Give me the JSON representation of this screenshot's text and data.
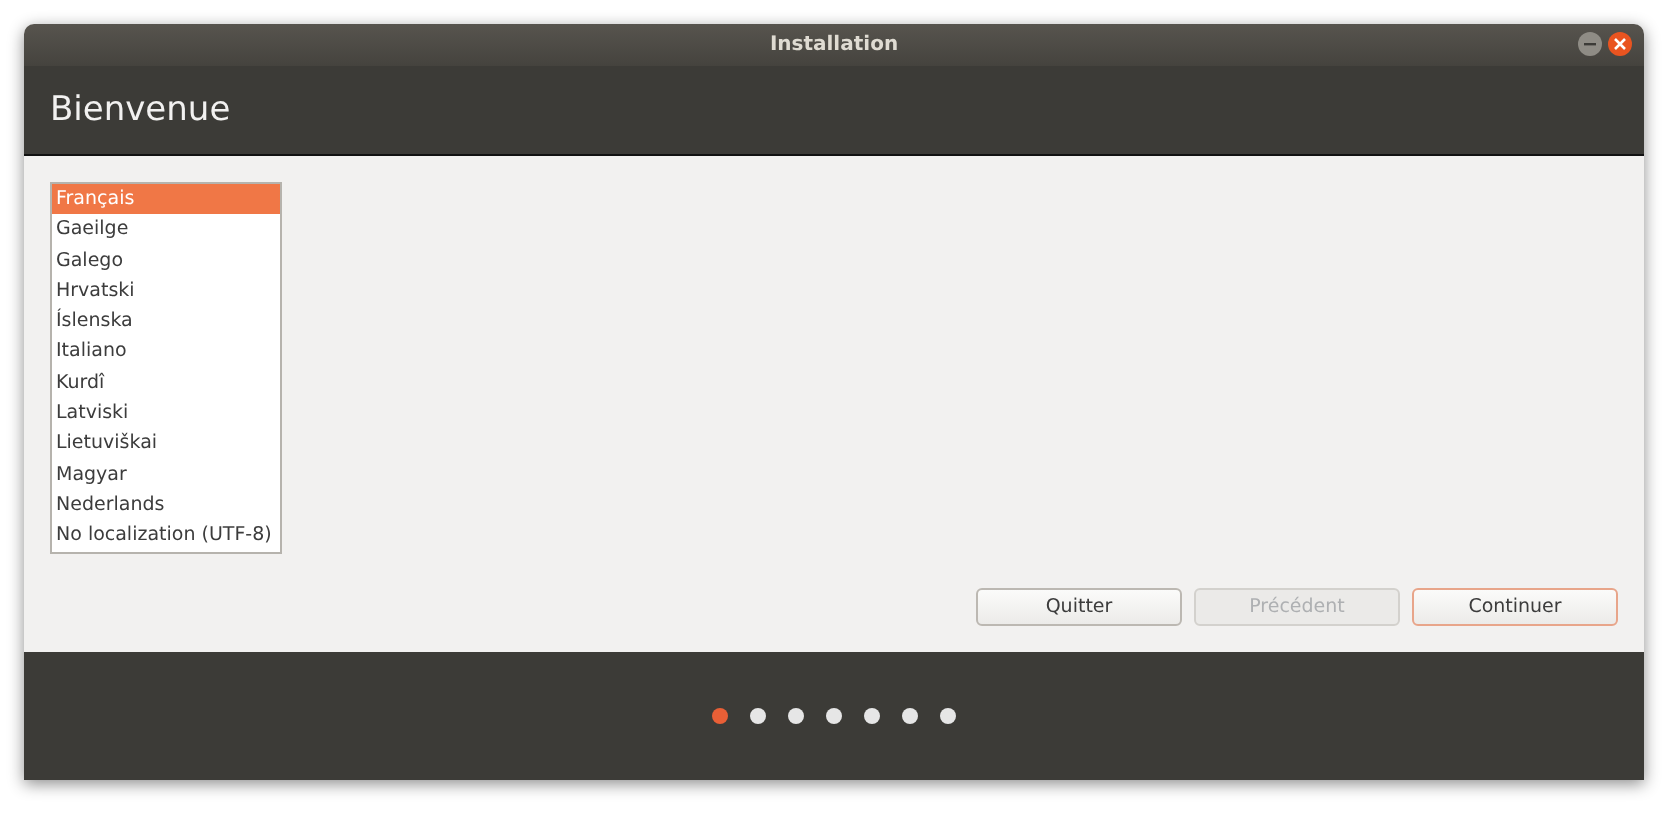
{
  "window": {
    "title": "Installation"
  },
  "header": {
    "title": "Bienvenue"
  },
  "languages": [
    {
      "label": "Français",
      "selected": true
    },
    {
      "label": "Gaeilge",
      "selected": false
    },
    {
      "label": "Galego",
      "selected": false
    },
    {
      "label": "Hrvatski",
      "selected": false
    },
    {
      "label": "Íslenska",
      "selected": false
    },
    {
      "label": "Italiano",
      "selected": false
    },
    {
      "label": "Kurdî",
      "selected": false
    },
    {
      "label": "Latviski",
      "selected": false
    },
    {
      "label": "Lietuviškai",
      "selected": false
    },
    {
      "label": "Magyar",
      "selected": false
    },
    {
      "label": "Nederlands",
      "selected": false
    },
    {
      "label": "No localization (UTF-8)",
      "selected": false
    }
  ],
  "buttons": [
    {
      "label": "Quitter",
      "kind": "normal",
      "disabled": false
    },
    {
      "label": "Précédent",
      "kind": "normal",
      "disabled": true
    },
    {
      "label": "Continuer",
      "kind": "suggested",
      "disabled": false
    }
  ],
  "progress_steps": [
    {
      "selected": true
    },
    {
      "selected": false
    },
    {
      "selected": false
    },
    {
      "selected": false
    },
    {
      "selected": false
    },
    {
      "selected": false
    },
    {
      "selected": false
    }
  ]
}
